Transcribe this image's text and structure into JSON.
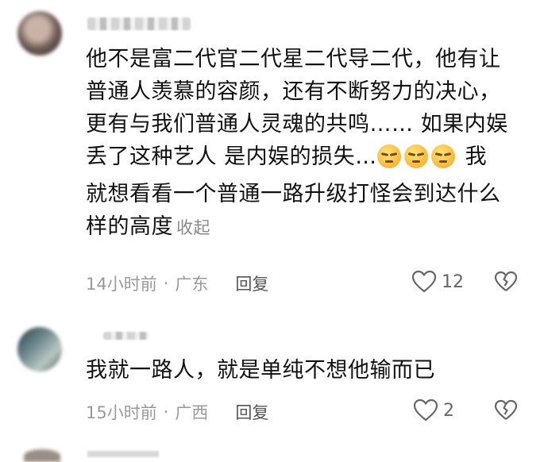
{
  "comments": [
    {
      "lines": [
        "他不是富二代官二代星二代导二代，他有让",
        "普通人羡慕的容颜，还有不断努力的决心，",
        "更有与我们普通人灵魂的共鸣…… 如果内娱",
        "丢了这种艺人  是内娱的损失…",
        " 我",
        "就想看看一个普通一路升级打怪会到达什么",
        "样的高度"
      ],
      "emoji_count": 3,
      "emoji_icon": "squint-smirk-emoji-icon",
      "collapse_label": "收起",
      "time": "14小时前",
      "separator": "·",
      "location": "广东",
      "reply_label": "回复",
      "likes": "12"
    },
    {
      "lines": [
        "我就一路人，就是单纯不想他输而已"
      ],
      "time": "15小时前",
      "separator": "·",
      "location": "广西",
      "reply_label": "回复",
      "likes": "2"
    }
  ]
}
